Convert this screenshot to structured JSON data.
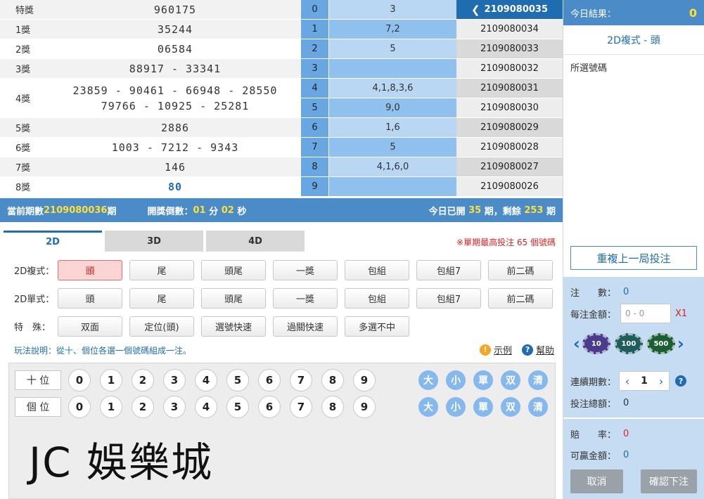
{
  "prizes": [
    {
      "name": "特獎",
      "lines": [
        "960175"
      ]
    },
    {
      "name": "1獎",
      "lines": [
        "35244"
      ]
    },
    {
      "name": "2獎",
      "lines": [
        "06584"
      ]
    },
    {
      "name": "3獎",
      "lines": [
        "88917 - 33341"
      ]
    },
    {
      "name": "4獎",
      "lines": [
        "23859 - 90461 - 66948 - 28550",
        "79766 - 10925 - 25281"
      ]
    },
    {
      "name": "5獎",
      "lines": [
        "2886"
      ]
    },
    {
      "name": "6獎",
      "lines": [
        "1003 - 7212 - 9343"
      ]
    },
    {
      "name": "7獎",
      "lines": [
        "146"
      ]
    },
    {
      "name": "8獎",
      "lines": [
        "80"
      ]
    }
  ],
  "digits": [
    {
      "idx": "0",
      "val": "3"
    },
    {
      "idx": "1",
      "val": "7,2"
    },
    {
      "idx": "2",
      "val": "5"
    },
    {
      "idx": "3",
      "val": ""
    },
    {
      "idx": "4",
      "val": "4,1,8,3,6"
    },
    {
      "idx": "5",
      "val": "9,0"
    },
    {
      "idx": "6",
      "val": "1,6"
    },
    {
      "idx": "7",
      "val": "5"
    },
    {
      "idx": "8",
      "val": "4,1,6,0"
    },
    {
      "idx": "9",
      "val": ""
    }
  ],
  "periods": [
    "2109080035",
    "2109080034",
    "2109080033",
    "2109080032",
    "2109080031",
    "2109080030",
    "2109080029",
    "2109080028",
    "2109080027",
    "2109080026"
  ],
  "status": {
    "current_label": "當前期數",
    "current_period": "2109080036",
    "period_suffix": "期",
    "countdown_label": "開獎倒數：",
    "min": "01",
    "min_unit": "分",
    "sec": "02",
    "sec_unit": "秒",
    "opened_label": "今日已開",
    "opened": "35",
    "opened_unit": "期，剩餘",
    "remain": "253",
    "remain_unit": "期"
  },
  "tabs": [
    "2D",
    "3D",
    "4D"
  ],
  "max_note": "※單期最高投注 65 個號碼",
  "option_rows": [
    {
      "label": "2D複式：",
      "buttons": [
        "頭",
        "尾",
        "頭尾",
        "一獎",
        "包組",
        "包組7",
        "前二碼"
      ]
    },
    {
      "label": "2D單式：",
      "buttons": [
        "頭",
        "尾",
        "頭尾",
        "一獎",
        "包組",
        "包組7",
        "前二碼"
      ]
    },
    {
      "label": "特　殊：",
      "buttons": [
        "双面",
        "定位(頭)",
        "選號快速",
        "過關快速",
        "多選不中"
      ]
    }
  ],
  "rule_text": "玩法說明：從十、個位各選一個號碼組成一注。",
  "help": {
    "example": "示例",
    "help": "幫助"
  },
  "number_rows": [
    {
      "label": "十 位",
      "balls": [
        "0",
        "1",
        "2",
        "3",
        "4",
        "5",
        "6",
        "7",
        "8",
        "9"
      ]
    },
    {
      "label": "個 位",
      "balls": [
        "0",
        "1",
        "2",
        "3",
        "4",
        "5",
        "6",
        "7",
        "8",
        "9"
      ]
    }
  ],
  "quick_buttons": [
    "大",
    "小",
    "單",
    "双",
    "清"
  ],
  "brand": "JC 娛樂城",
  "sidebar": {
    "today_label": "今日結果：",
    "today_count": "0",
    "mode": "2D複式 - 頭",
    "selected_label": "所選號碼",
    "repeat_label": "重複上一局投注",
    "notes_label": "注　　數：",
    "notes_value": "0",
    "amount_label": "每注金額：",
    "amount_placeholder": "0 - 0",
    "multiplier": "X1",
    "chips": [
      "10",
      "100",
      "500"
    ],
    "periods_label": "連續期數：",
    "periods_value": "1",
    "total_label": "投注總額：",
    "total_value": "0",
    "odds_label": "賠　　率：",
    "odds_value": "0",
    "win_label": "可贏金額：",
    "win_value": "0",
    "cancel_label": "取消",
    "confirm_label": "確認下注"
  },
  "colors": {
    "accent": "#1f6cb0",
    "bar": "#4b8bc8",
    "highlight": "#ffe033",
    "warning": "#e02020"
  }
}
